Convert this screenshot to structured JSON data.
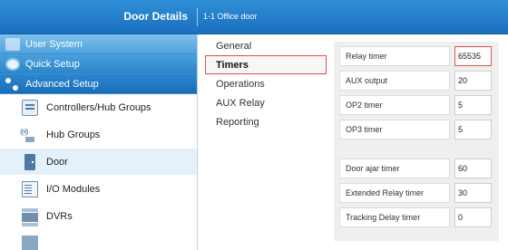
{
  "header": {
    "title": "Door Details",
    "subtitle": "1-1 Office door"
  },
  "sidebar": {
    "sections": [
      {
        "label": "User System",
        "icon": "users-icon"
      },
      {
        "label": "Quick Setup",
        "icon": "quick-setup-icon"
      },
      {
        "label": "Advanced Setup",
        "icon": "network-icon"
      }
    ],
    "items": [
      {
        "label": "Controllers/Hub Groups",
        "icon": "controller-icon"
      },
      {
        "label": "Hub Groups",
        "icon": "hub-icon"
      },
      {
        "label": "Door",
        "icon": "door-icon"
      },
      {
        "label": "I/O Modules",
        "icon": "io-module-icon"
      },
      {
        "label": "DVRs",
        "icon": "dvr-icon"
      }
    ]
  },
  "tabs": [
    {
      "label": "General"
    },
    {
      "label": "Timers"
    },
    {
      "label": "Operations"
    },
    {
      "label": "AUX Relay"
    },
    {
      "label": "Reporting"
    }
  ],
  "timers": {
    "group1": [
      {
        "label": "Relay timer",
        "value": "65535"
      },
      {
        "label": "AUX output",
        "value": "20"
      },
      {
        "label": "OP2 timer",
        "value": "5"
      },
      {
        "label": "OP3 timer",
        "value": "5"
      }
    ],
    "group2": [
      {
        "label": "Door ajar timer",
        "value": "60"
      },
      {
        "label": "Extended Relay timer",
        "value": "30"
      },
      {
        "label": "Tracking Delay timer",
        "value": "0"
      }
    ]
  }
}
